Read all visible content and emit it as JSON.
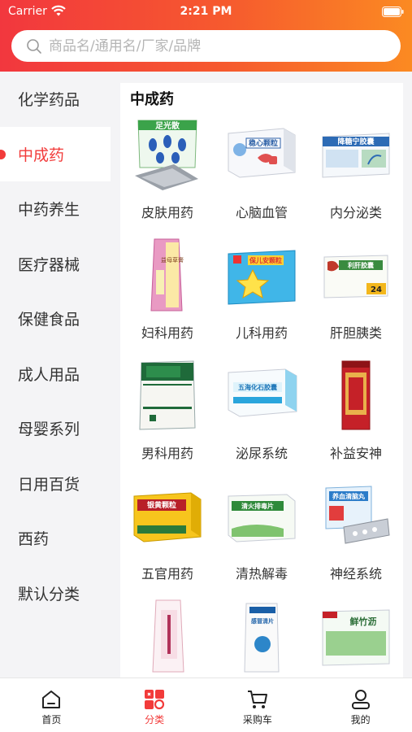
{
  "status_bar": {
    "carrier": "Carrier",
    "time": "2:21 PM"
  },
  "search": {
    "placeholder": "商品名/通用名/厂家/品牌"
  },
  "sidebar": {
    "items": [
      {
        "label": "化学药品"
      },
      {
        "label": "中成药",
        "active": true
      },
      {
        "label": "中药养生"
      },
      {
        "label": "医疗器械"
      },
      {
        "label": "保健食品"
      },
      {
        "label": "成人用品"
      },
      {
        "label": "母婴系列"
      },
      {
        "label": "日用百货"
      },
      {
        "label": "西药"
      },
      {
        "label": "默认分类"
      }
    ]
  },
  "content": {
    "title": "中成药",
    "items": [
      {
        "label": "皮肤用药",
        "box_text": "足光散",
        "icon": "product-foot-powder-icon"
      },
      {
        "label": "心脑血管",
        "box_text": "稳心颗粒",
        "icon": "product-heart-granule-icon"
      },
      {
        "label": "内分泌类",
        "box_text": "降糖宁胶囊",
        "icon": "product-capsule-box-icon"
      },
      {
        "label": "妇科用药",
        "box_text": "益母草膏",
        "icon": "product-tall-box-icon"
      },
      {
        "label": "儿科用药",
        "box_text": "保儿安颗粒",
        "icon": "product-star-box-icon"
      },
      {
        "label": "肝胆胰类",
        "box_text": "利肝胶囊",
        "icon": "product-liver-box-icon"
      },
      {
        "label": "男科用药",
        "box_text": "",
        "icon": "product-green-box-icon"
      },
      {
        "label": "泌尿系统",
        "box_text": "五海化石胶囊",
        "icon": "product-blue-box-icon"
      },
      {
        "label": "补益安神",
        "box_text": "",
        "icon": "product-red-bottle-icon"
      },
      {
        "label": "五官用药",
        "box_text": "银黄颗粒",
        "icon": "product-yellow-box-icon"
      },
      {
        "label": "清热解毒",
        "box_text": "清火排毒片",
        "icon": "product-green-white-box-icon"
      },
      {
        "label": "神经系统",
        "box_text": "养血清脑丸",
        "icon": "product-blister-pack-icon"
      },
      {
        "label": "",
        "box_text": "",
        "icon": "product-pink-tall-box-icon"
      },
      {
        "label": "",
        "box_text": "感冒清片",
        "icon": "product-blue-bottle-icon"
      },
      {
        "label": "",
        "box_text": "鲜竹沥",
        "icon": "product-bamboo-box-icon"
      }
    ]
  },
  "tabbar": {
    "tabs": [
      {
        "label": "首页",
        "icon": "home-icon"
      },
      {
        "label": "分类",
        "icon": "category-icon",
        "active": true
      },
      {
        "label": "采购车",
        "icon": "cart-icon"
      },
      {
        "label": "我的",
        "icon": "profile-icon"
      }
    ]
  },
  "colors": {
    "accent": "#f23b3a",
    "header_gradient_start": "#f2373e",
    "header_gradient_end": "#fb8a22"
  }
}
